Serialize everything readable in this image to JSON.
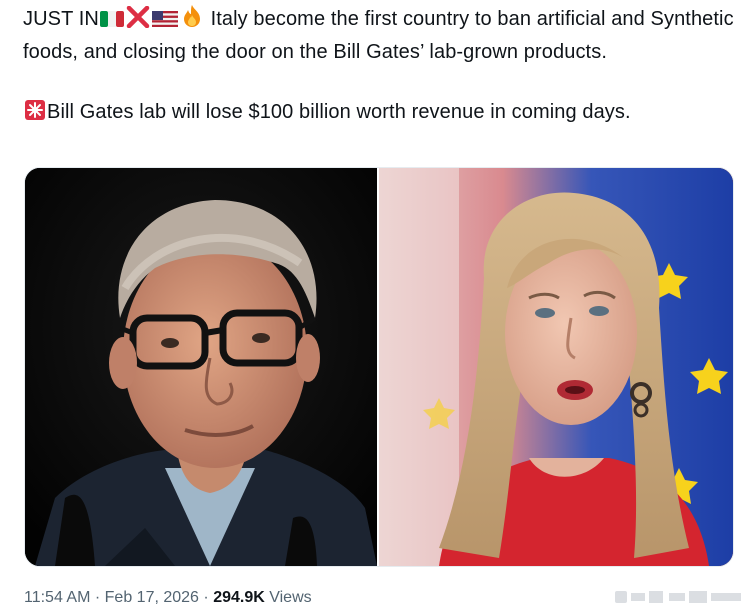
{
  "tweet": {
    "prefix": "JUST IN",
    "flag_icons": [
      "italy-flag-icon",
      "cross-mark-icon",
      "us-flag-icon",
      "fire-icon"
    ],
    "line1_text": "Italy become the first country to ban artificial and Synthetic foods, and closing the door on the Bill Gates’ lab-grown products.",
    "siren_icon": "rotating-light-icon",
    "line2_text": "Bill Gates lab will lose $100 billion worth revenue in coming days."
  },
  "media": {
    "photos": [
      "bill-gates-photo",
      "giorgia-meloni-photo"
    ]
  },
  "meta": {
    "time": "11:54 AM",
    "separator": "·",
    "date": "Feb 17, 2026",
    "views_count": "294.9K",
    "views_label": "Views"
  },
  "colors": {
    "text": "#0f1419",
    "muted": "#536471",
    "eu_blue": "#1e3fa8",
    "red_dress": "#d4252f"
  }
}
